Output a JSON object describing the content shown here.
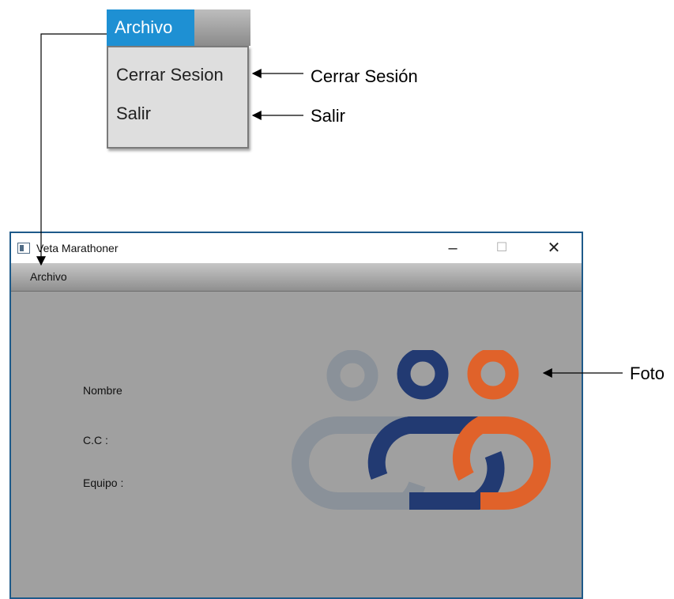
{
  "zoomed_menu": {
    "menu_label": "Archivo",
    "items": [
      {
        "label": "Cerrar Sesion"
      },
      {
        "label": "Salir"
      }
    ]
  },
  "callouts": {
    "cerrar_sesion": "Cerrar Sesión",
    "salir": "Salir",
    "foto": "Foto"
  },
  "window": {
    "title": "Veta Marathoner",
    "controls": {
      "minimize": "–",
      "maximize": "☐",
      "close": "✕"
    },
    "menubar": {
      "archivo": "Archivo"
    },
    "fields": {
      "nombre": "Nombre",
      "cc": "C.C :",
      "equipo": "Equipo :"
    },
    "photo_icon": "team-logo-icon"
  },
  "colors": {
    "menu_highlight": "#1e90d3",
    "content_bg": "#a0a0a0",
    "logo_gray": "#8a9199",
    "logo_blue": "#223a72",
    "logo_orange": "#e0622a"
  }
}
